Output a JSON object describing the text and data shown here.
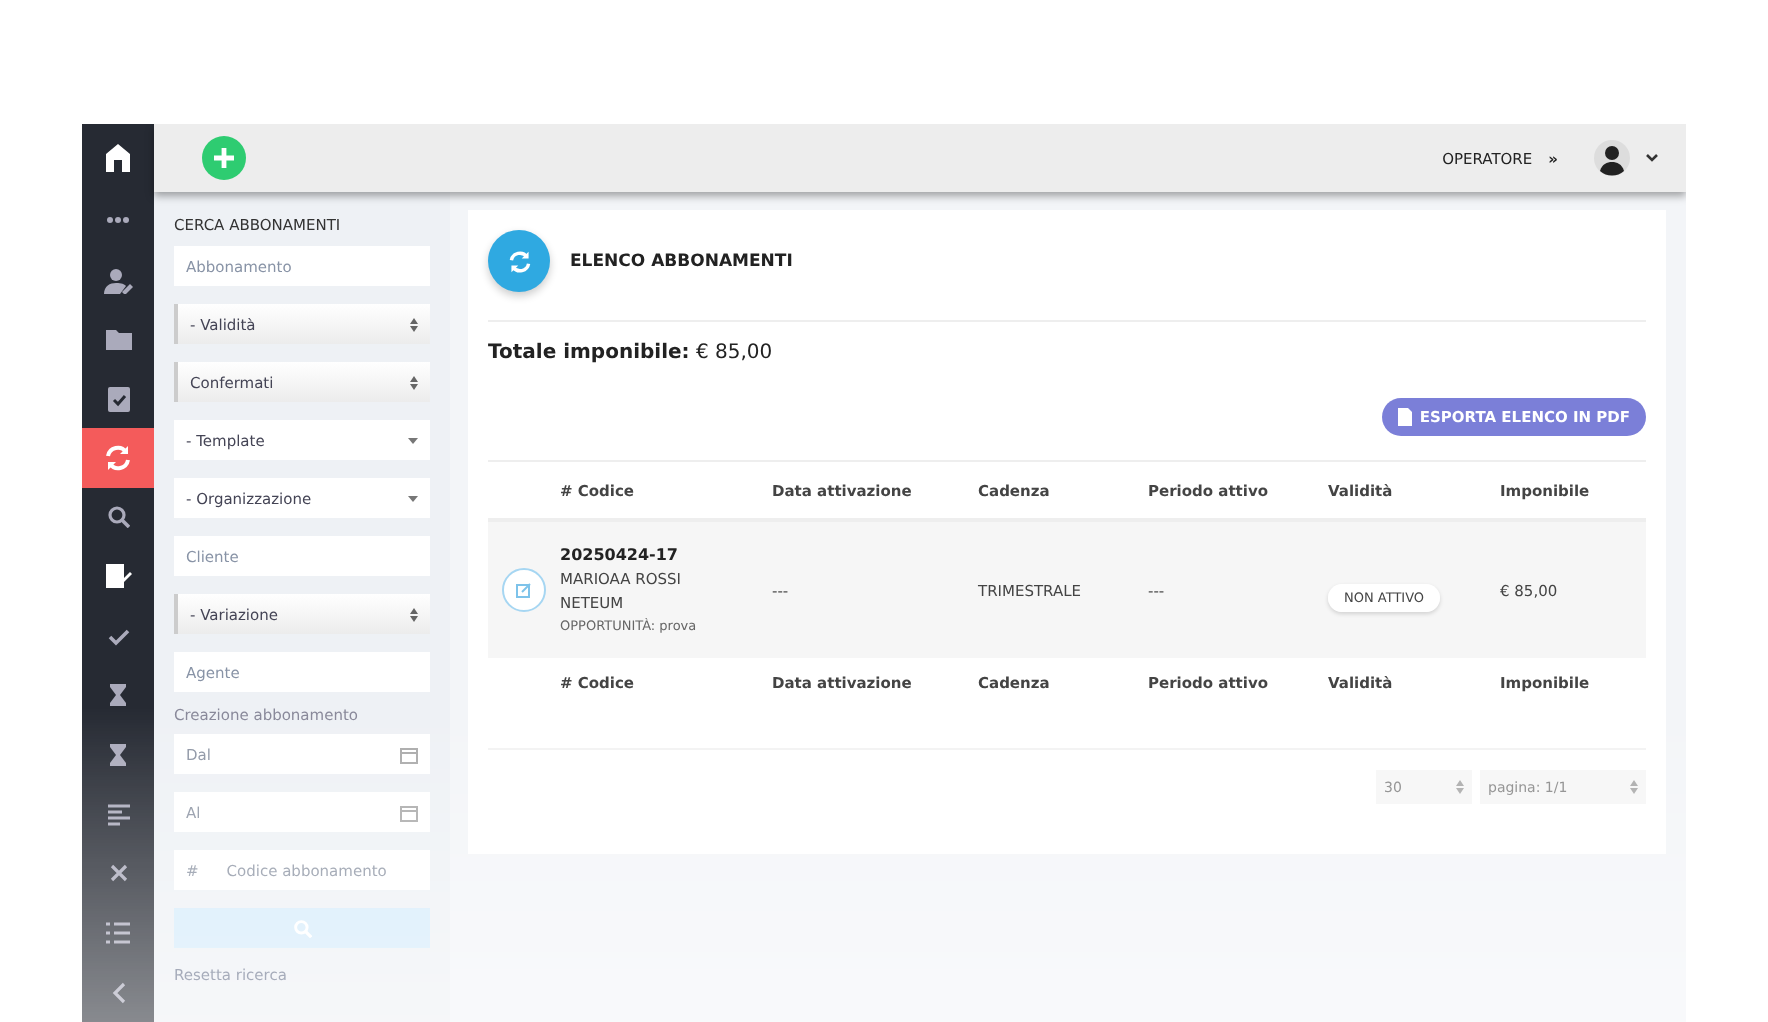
{
  "nav_items": [
    {
      "selected": false
    },
    {
      "selected": false
    },
    {
      "selected": false
    },
    {
      "selected": false
    },
    {
      "selected": false
    },
    {
      "selected": true
    },
    {
      "selected": false
    },
    {
      "selected": false
    },
    {
      "selected": false
    },
    {
      "selected": false
    },
    {
      "selected": false
    },
    {
      "selected": false
    },
    {
      "selected": false
    },
    {
      "selected": false
    },
    {
      "selected": false
    }
  ],
  "top_bar": {
    "operator": "OPERATORE",
    "operator_icon": "»"
  },
  "filters": {
    "title": "CERCA ABBONAMENTI",
    "fields": [
      {
        "kind": "input",
        "placeholder": "Abbonamento"
      },
      {
        "kind": "select",
        "value": "- Validità"
      },
      {
        "kind": "select",
        "value": "Confermati"
      },
      {
        "kind": "dropdown",
        "value": "- Template"
      },
      {
        "kind": "dropdown",
        "value": "- Organizzazione"
      },
      {
        "kind": "input",
        "placeholder": "Cliente"
      },
      {
        "kind": "select",
        "value": "- Variazione"
      },
      {
        "kind": "input",
        "placeholder": "Agente"
      },
      {
        "kind": "label",
        "text": "Creazione abbonamento"
      },
      {
        "kind": "date",
        "placeholder": "Dal"
      },
      {
        "kind": "date",
        "placeholder": "Al"
      },
      {
        "kind": "prefixed",
        "prefix": "#",
        "placeholder": "Codice abbonamento"
      },
      {
        "kind": "search_button"
      },
      {
        "kind": "link",
        "text": "Resetta ricerca"
      }
    ]
  },
  "panel": {
    "title": "ELENCO ABBONAMENTI",
    "total_label": "Totale imponibile:",
    "total_value": "€ 85,00",
    "export_button": "ESPORTA ELENCO IN PDF",
    "columns": [
      "# Codice",
      "Data attivazione",
      "Cadenza",
      "Periodo attivo",
      "Validità",
      "Imponibile"
    ],
    "footer_columns": [
      "# Codice",
      "Data attivazione",
      "Cadenza",
      "Periodo attivo",
      "Validità",
      "Imponibile"
    ],
    "rows": [
      {
        "code": "20250424-17",
        "client": "MARIOAA ROSSI",
        "org": "NETEUM",
        "note": "OPPORTUNITÀ: prova",
        "activation": "---",
        "cadence": "TRIMESTRALE",
        "period": "---",
        "validity": "NON ATTIVO",
        "amount": "€ 85,00"
      }
    ],
    "page_size": "30",
    "page": "pagina: 1/1"
  }
}
